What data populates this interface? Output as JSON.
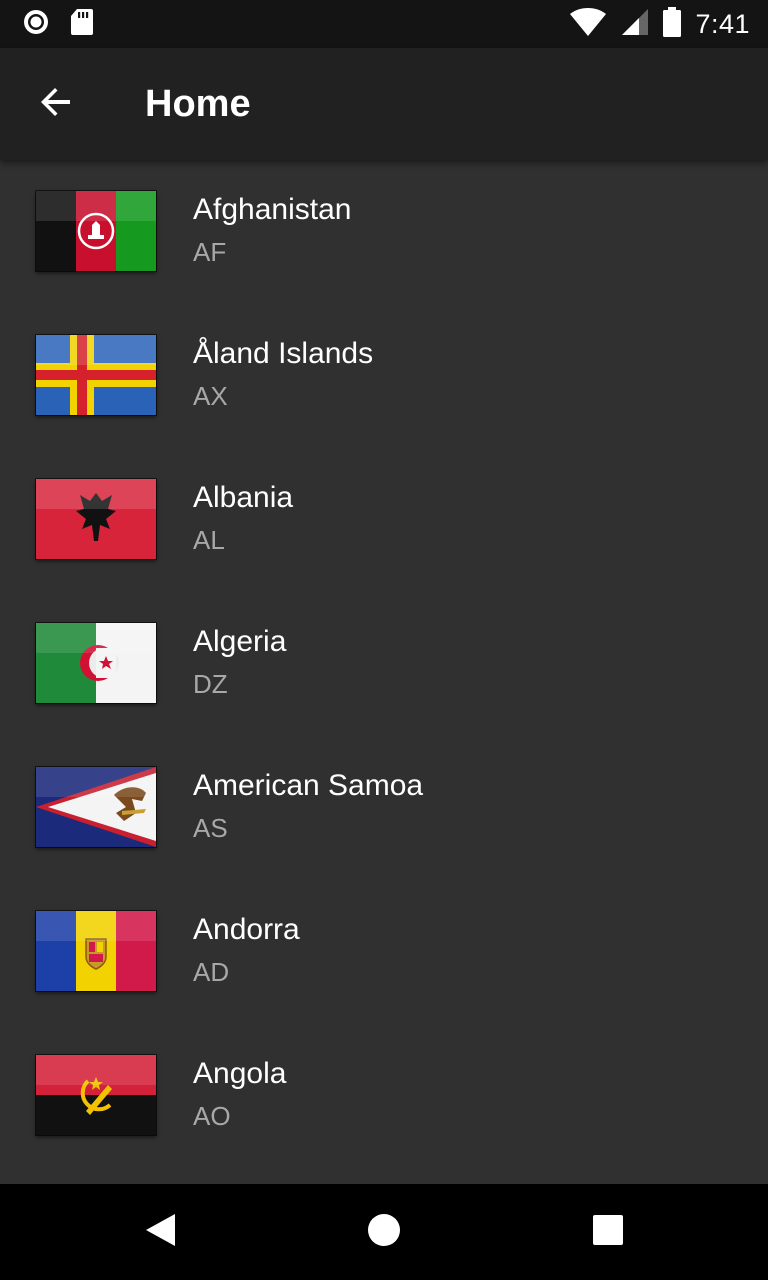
{
  "status_bar": {
    "time": "7:41",
    "icons": [
      "record-icon",
      "sd-card-icon",
      "wifi-icon",
      "cellular-signal-icon",
      "battery-icon"
    ]
  },
  "app_bar": {
    "title": "Home",
    "back_icon": "arrow-back-icon"
  },
  "countries": [
    {
      "name": "Afghanistan",
      "code": "AF"
    },
    {
      "name": "Åland Islands",
      "code": "AX"
    },
    {
      "name": "Albania",
      "code": "AL"
    },
    {
      "name": "Algeria",
      "code": "DZ"
    },
    {
      "name": "American Samoa",
      "code": "AS"
    },
    {
      "name": "Andorra",
      "code": "AD"
    },
    {
      "name": "Angola",
      "code": "AO"
    }
  ],
  "nav_bar": {
    "icons": [
      "back-triangle-icon",
      "home-circle-icon",
      "recents-square-icon"
    ]
  },
  "colors": {
    "background": "#303030",
    "app_bar": "#212121",
    "status_bar": "#141414",
    "primary_text": "#ffffff",
    "secondary_text": "#a8a8a8"
  }
}
